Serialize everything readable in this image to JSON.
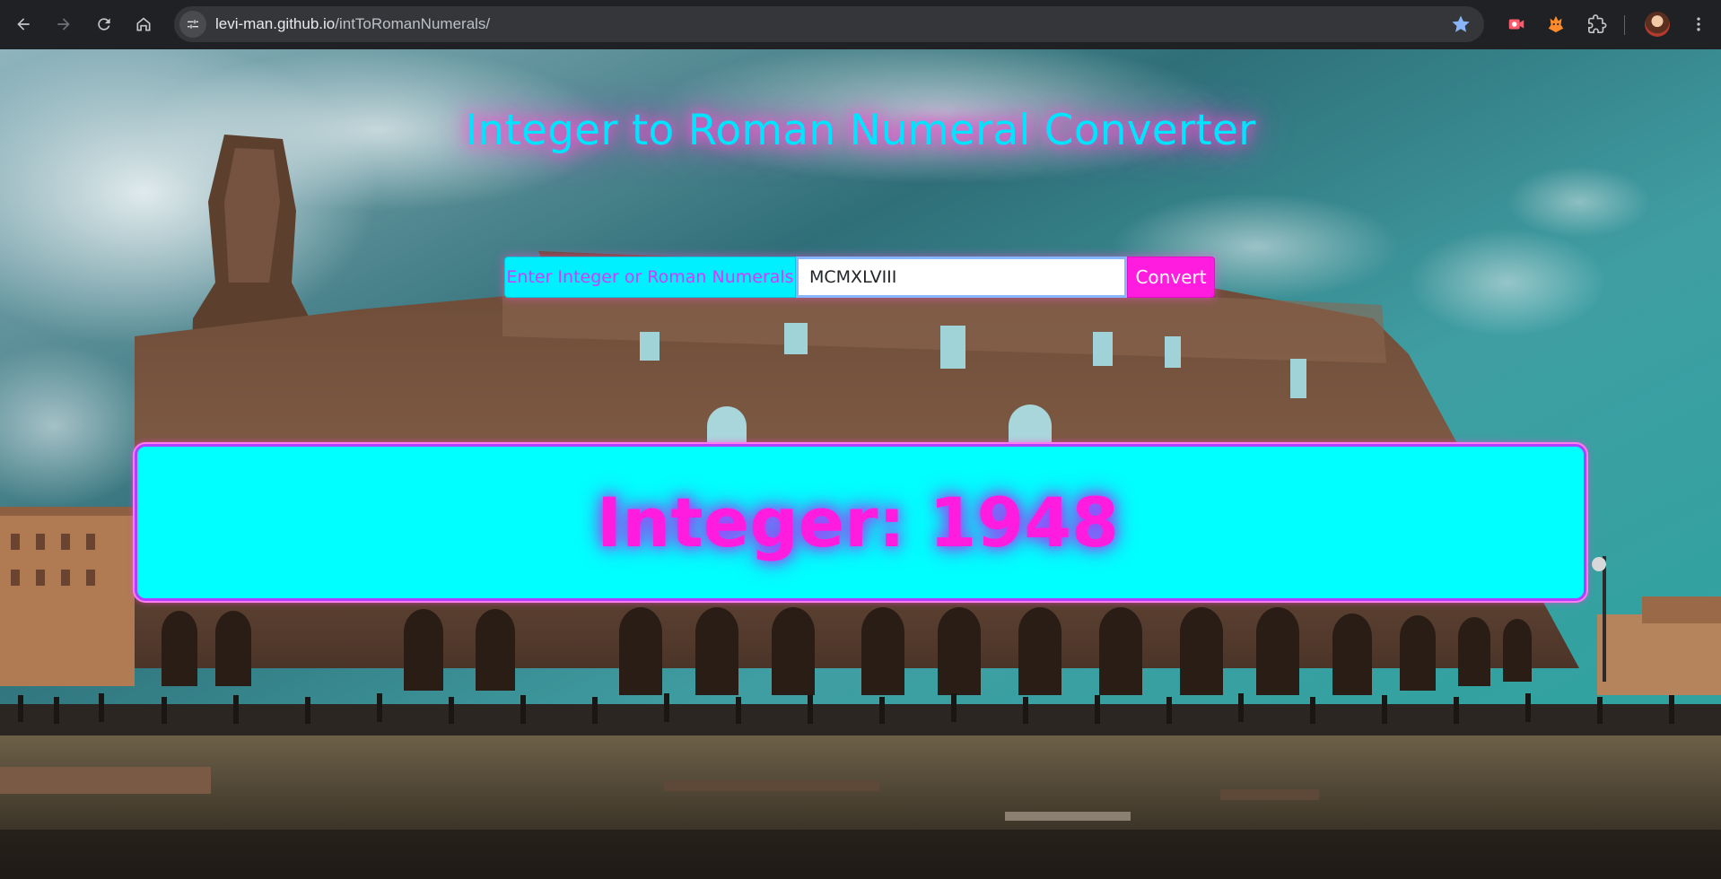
{
  "browser": {
    "url_host": "levi-man.github.io",
    "url_path": "/intToRomanNumerals/",
    "accent_color": "#8ab4f8"
  },
  "page": {
    "title": "Integer to Roman Numeral Converter",
    "input_label": "Enter Integer or Roman Numerals",
    "input_value": "MCMXLVIII",
    "convert_label": "Convert",
    "result_text": "Integer: 1948",
    "colors": {
      "cyan": "#00ffff",
      "magenta": "#ff1cdf",
      "purple": "#b040ff"
    }
  }
}
